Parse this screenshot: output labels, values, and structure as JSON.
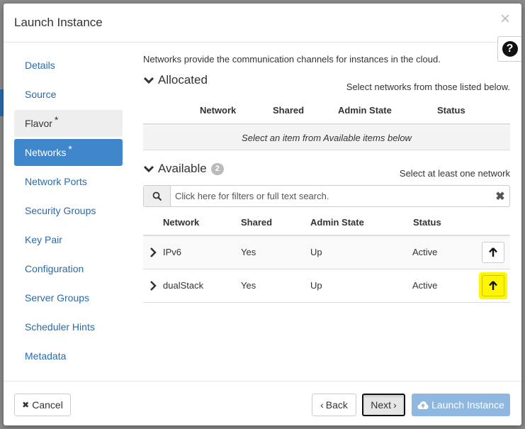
{
  "modal": {
    "title": "Launch Instance",
    "close_glyph": "×",
    "help_glyph": "?"
  },
  "sidebar": {
    "items": [
      {
        "label": "Details",
        "required": false
      },
      {
        "label": "Source",
        "required": false
      },
      {
        "label": "Flavor",
        "required": true
      },
      {
        "label": "Networks",
        "required": true
      },
      {
        "label": "Network Ports",
        "required": false
      },
      {
        "label": "Security Groups",
        "required": false
      },
      {
        "label": "Key Pair",
        "required": false
      },
      {
        "label": "Configuration",
        "required": false
      },
      {
        "label": "Server Groups",
        "required": false
      },
      {
        "label": "Scheduler Hints",
        "required": false
      },
      {
        "label": "Metadata",
        "required": false
      }
    ],
    "required_mark": "*"
  },
  "content": {
    "intro": "Networks provide the communication channels for instances in the cloud.",
    "allocated": {
      "title": "Allocated",
      "hint": "Select networks from those listed below.",
      "columns": [
        "Network",
        "Shared",
        "Admin State",
        "Status"
      ],
      "empty_text": "Select an item from Available items below"
    },
    "available": {
      "title": "Available",
      "count": "2",
      "hint": "Select at least one network",
      "search_placeholder": "Click here for filters or full text search.",
      "clear_glyph": "✖",
      "columns": [
        "Network",
        "Shared",
        "Admin State",
        "Status"
      ],
      "rows": [
        {
          "network": "IPv6",
          "shared": "Yes",
          "admin_state": "Up",
          "status": "Active"
        },
        {
          "network": "dualStack",
          "shared": "Yes",
          "admin_state": "Up",
          "status": "Active"
        }
      ]
    }
  },
  "footer": {
    "cancel_label": "Cancel",
    "cancel_glyph": "✖",
    "back_label": "Back",
    "back_glyph": "‹",
    "next_label": "Next",
    "next_glyph": "›",
    "launch_label": "Launch Instance"
  },
  "colors": {
    "accent": "#3f86cb",
    "highlight": "#fff700",
    "primary_disabled": "#8fb8e0"
  }
}
